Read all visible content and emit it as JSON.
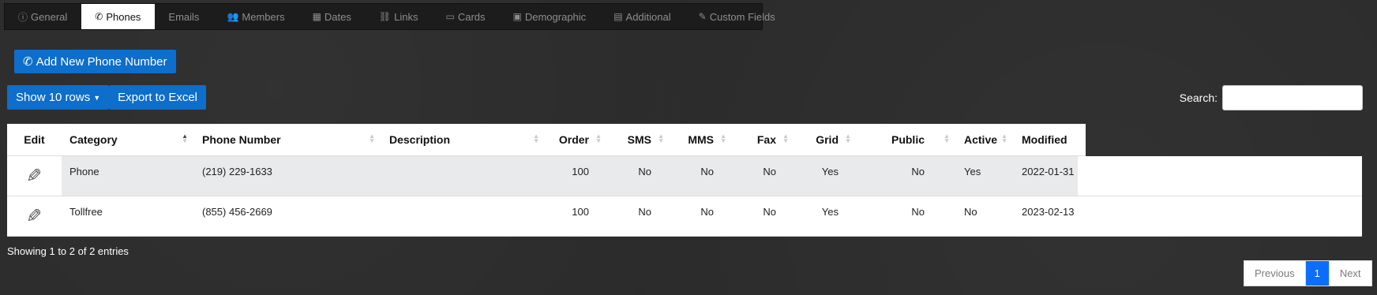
{
  "tabs": [
    {
      "label": "General",
      "icon": "info-icon",
      "glyph": "ⓘ"
    },
    {
      "label": "Phones",
      "icon": "phone-icon",
      "glyph": "✆",
      "active": true
    },
    {
      "label": "Emails",
      "icon": "",
      "glyph": ""
    },
    {
      "label": "Members",
      "icon": "members-icon",
      "glyph": "👥"
    },
    {
      "label": "Dates",
      "icon": "calendar-icon",
      "glyph": "▦"
    },
    {
      "label": "Links",
      "icon": "link-icon",
      "glyph": "⛓"
    },
    {
      "label": "Cards",
      "icon": "card-icon",
      "glyph": "▭"
    },
    {
      "label": "Demographic",
      "icon": "id-card-icon",
      "glyph": "▣"
    },
    {
      "label": "Additional",
      "icon": "note-icon",
      "glyph": "▤"
    },
    {
      "label": "Custom Fields",
      "icon": "edit-icon",
      "glyph": "✎"
    }
  ],
  "toolbar": {
    "add_label": "Add New Phone Number",
    "show_rows_label": "Show 10 rows",
    "export_label": "Export to Excel",
    "search_label": "Search:",
    "search_value": ""
  },
  "table": {
    "columns": [
      "Edit",
      "Category",
      "Phone Number",
      "Description",
      "Order",
      "SMS",
      "MMS",
      "Fax",
      "Grid",
      "Public",
      "Active",
      "Modified"
    ],
    "rows": [
      [
        "Phone",
        "(219) 229-1633",
        "",
        "100",
        "No",
        "No",
        "No",
        "Yes",
        "No",
        "Yes",
        "2022-01-31"
      ],
      [
        "Tollfree",
        "(855) 456-2669",
        "",
        "100",
        "No",
        "No",
        "No",
        "Yes",
        "No",
        "No",
        "2023-02-13"
      ]
    ]
  },
  "footer": {
    "info": "Showing 1 to 2 of 2 entries",
    "previous": "Previous",
    "page": "1",
    "next": "Next"
  },
  "colors": {
    "accent": "#0d6ecb",
    "page_active": "#0d6efd",
    "background": "#2b2b2b"
  }
}
